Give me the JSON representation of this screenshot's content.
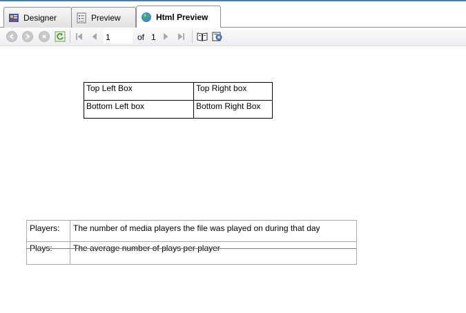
{
  "tabs": [
    {
      "label": "Designer",
      "icon": "designer-icon",
      "active": false
    },
    {
      "label": "Preview",
      "icon": "preview-icon",
      "active": false
    },
    {
      "label": "Html Preview",
      "icon": "globe-icon",
      "active": true
    }
  ],
  "toolbar": {
    "page_value": "1",
    "of_label": "of",
    "total_pages": "1"
  },
  "report": {
    "boxes": {
      "top_left": "Top Left Box",
      "top_right": "Top Right box",
      "bottom_left": "Bottom Left box",
      "bottom_right": "Bottom Right Box"
    },
    "legend": [
      {
        "term": "Players:",
        "description": "The number of media players the file was played on during that day"
      },
      {
        "term": "Plays:",
        "description": "The average number of plays per player"
      }
    ]
  },
  "colors": {
    "accent_strip": "#3c7fb1",
    "tab_border": "#898c95",
    "legend_border": "#a8a8a8"
  }
}
